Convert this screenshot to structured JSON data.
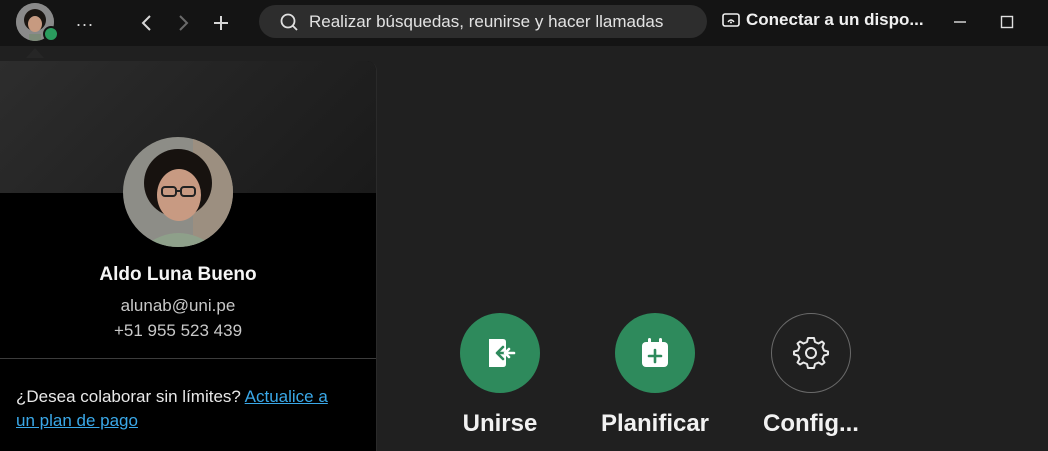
{
  "titlebar": {
    "more_label": "...",
    "search_placeholder": "Realizar búsquedas, reunirse y hacer llamadas",
    "connect_label": "Conectar a un dispo..."
  },
  "actions": [
    {
      "label": "Unirse",
      "icon": "join-icon"
    },
    {
      "label": "Planificar",
      "icon": "calendar-plus-icon"
    },
    {
      "label": "Config...",
      "icon": "gear-icon"
    }
  ],
  "profile": {
    "name": "Aldo Luna Bueno",
    "email": "alunab@uni.pe",
    "phone": "+51 955 523 439",
    "upsell_text": "¿Desea colaborar sin límites? ",
    "upsell_link": "Actualice a un plan de pago "
  },
  "colors": {
    "accent_green": "#2e8a5c",
    "presence": "#2a9c5e",
    "link": "#3aa8e8"
  }
}
